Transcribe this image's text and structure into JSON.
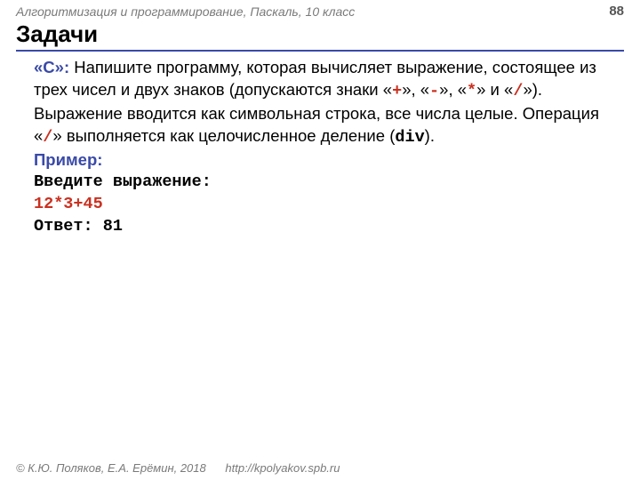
{
  "header": {
    "course": "Алгоритмизация и программирование, Паскаль, 10 класс",
    "page": "88"
  },
  "title": "Задачи",
  "task": {
    "label": "«C»:",
    "text_before_ops": " Напишите программу, которая вычисляет выражение, состоящее из трех чисел и двух знаков (допускаются знаки «",
    "op1": "+",
    "text_sep1": "», «",
    "op2": "-",
    "text_sep2": "», «",
    "op3": "*",
    "text_sep3": "» и «",
    "op4": "/",
    "text_after_ops1": "»). Выражение вводится как символьная строка, все числа целые. Операция «",
    "op5": "/",
    "text_after_ops2": "» выполняется как целочисленное деление (",
    "div_kw": "div",
    "text_end": ")."
  },
  "example": {
    "label": "Пример:",
    "prompt": "Введите выражение:",
    "input": "12*3+45",
    "answer_label": "Ответ: ",
    "answer_value": "81"
  },
  "footer": {
    "copyright": "© К.Ю. Поляков, Е.А. Ерёмин, 2018",
    "url": "http://kpolyakov.spb.ru"
  }
}
